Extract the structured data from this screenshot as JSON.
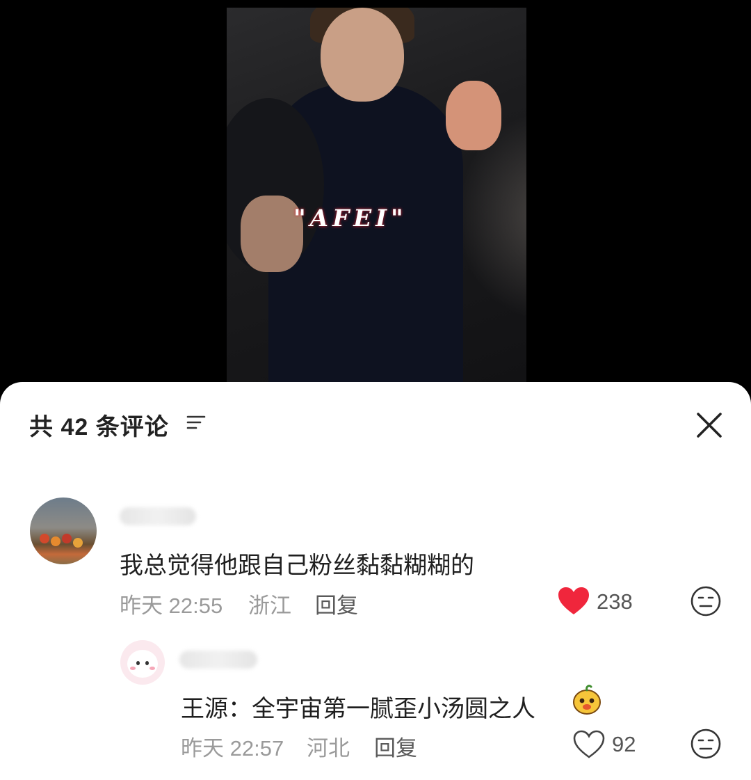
{
  "video": {
    "watermark": "\"AFEI\""
  },
  "sheet": {
    "title": "共 42 条评论",
    "sort_icon": "sort-lines-icon",
    "close_icon": "close-icon"
  },
  "comments": [
    {
      "text": "我总觉得他跟自己粉丝黏黏糊糊的",
      "time": "昨天 22:55",
      "location": "浙江",
      "reply_label": "回复",
      "likes": "238",
      "liked": true,
      "like_color": "#f0263c",
      "like_icon": "heart-filled-icon",
      "dislike_icon": "meh-face-icon"
    },
    {
      "text": "王源：全宇宙第一腻歪小汤圆之人",
      "emoji": "mango-mascot-emoji",
      "time": "昨天 22:57",
      "location": "河北",
      "reply_label": "回复",
      "likes": "92",
      "liked": false,
      "like_icon": "heart-outline-icon",
      "dislike_icon": "meh-face-icon"
    }
  ]
}
